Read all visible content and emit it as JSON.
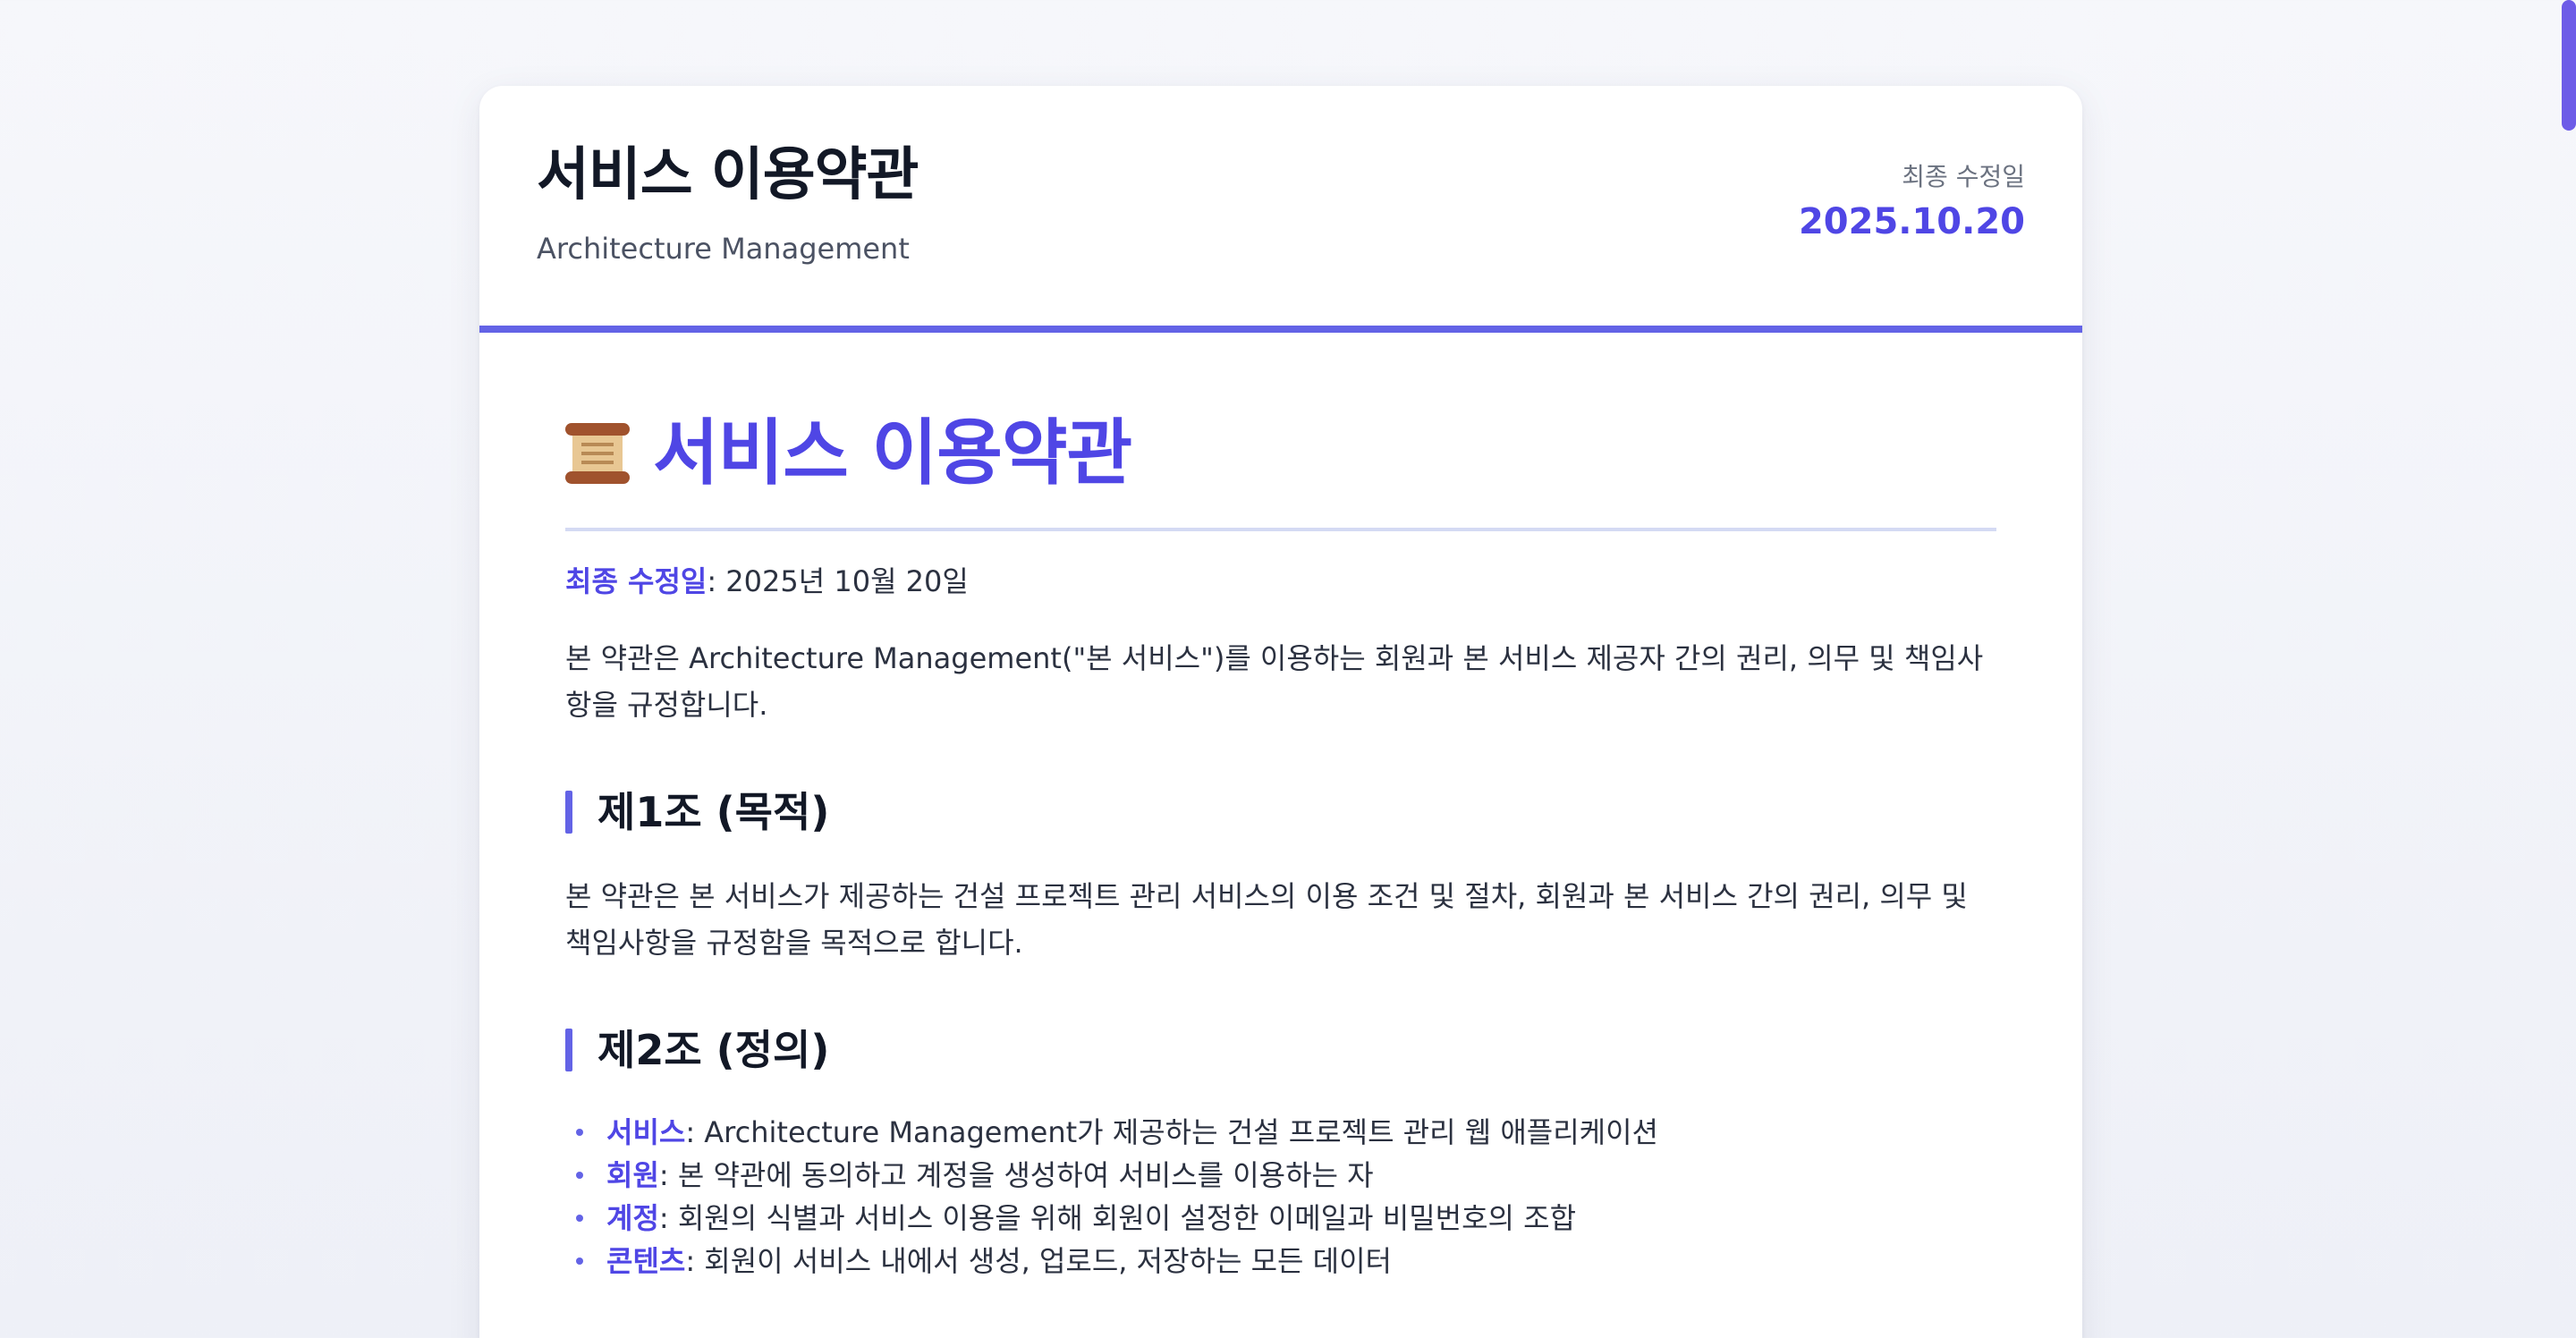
{
  "header": {
    "title": "서비스 이용약관",
    "subtitle": "Architecture Management",
    "updated_label": "최종 수정일",
    "updated_date": "2025.10.20"
  },
  "document": {
    "icon": "scroll-icon",
    "title": "서비스 이용약관",
    "meta_label": "최종 수정일",
    "meta_value": ": 2025년 10월 20일",
    "intro": "본 약관은 Architecture Management(\"본 서비스\")를 이용하는 회원과 본 서비스 제공자 간의 권리, 의무 및 책임사항을 규정합니다.",
    "sections": [
      {
        "heading": "제1조 (목적)",
        "body": "본 약관은 본 서비스가 제공하는 건설 프로젝트 관리 서비스의 이용 조건 및 절차, 회원과 본 서비스 간의 권리, 의무 및 책임사항을 규정함을 목적으로 합니다."
      },
      {
        "heading": "제2조 (정의)",
        "definitions": [
          {
            "term": "서비스",
            "text": ": Architecture Management가 제공하는 건설 프로젝트 관리 웹 애플리케이션"
          },
          {
            "term": "회원",
            "text": ": 본 약관에 동의하고 계정을 생성하여 서비스를 이용하는 자"
          },
          {
            "term": "계정",
            "text": ": 회원의 식별과 서비스 이용을 위해 회원이 설정한 이메일과 비밀번호의 조합"
          },
          {
            "term": "콘텐츠",
            "text": ": 회원이 서비스 내에서 생성, 업로드, 저장하는 모든 데이터"
          }
        ]
      }
    ]
  },
  "colors": {
    "accent": "#4f46e5",
    "accent_bar": "#6363e6",
    "scrollbar": "#6d5ce7"
  }
}
